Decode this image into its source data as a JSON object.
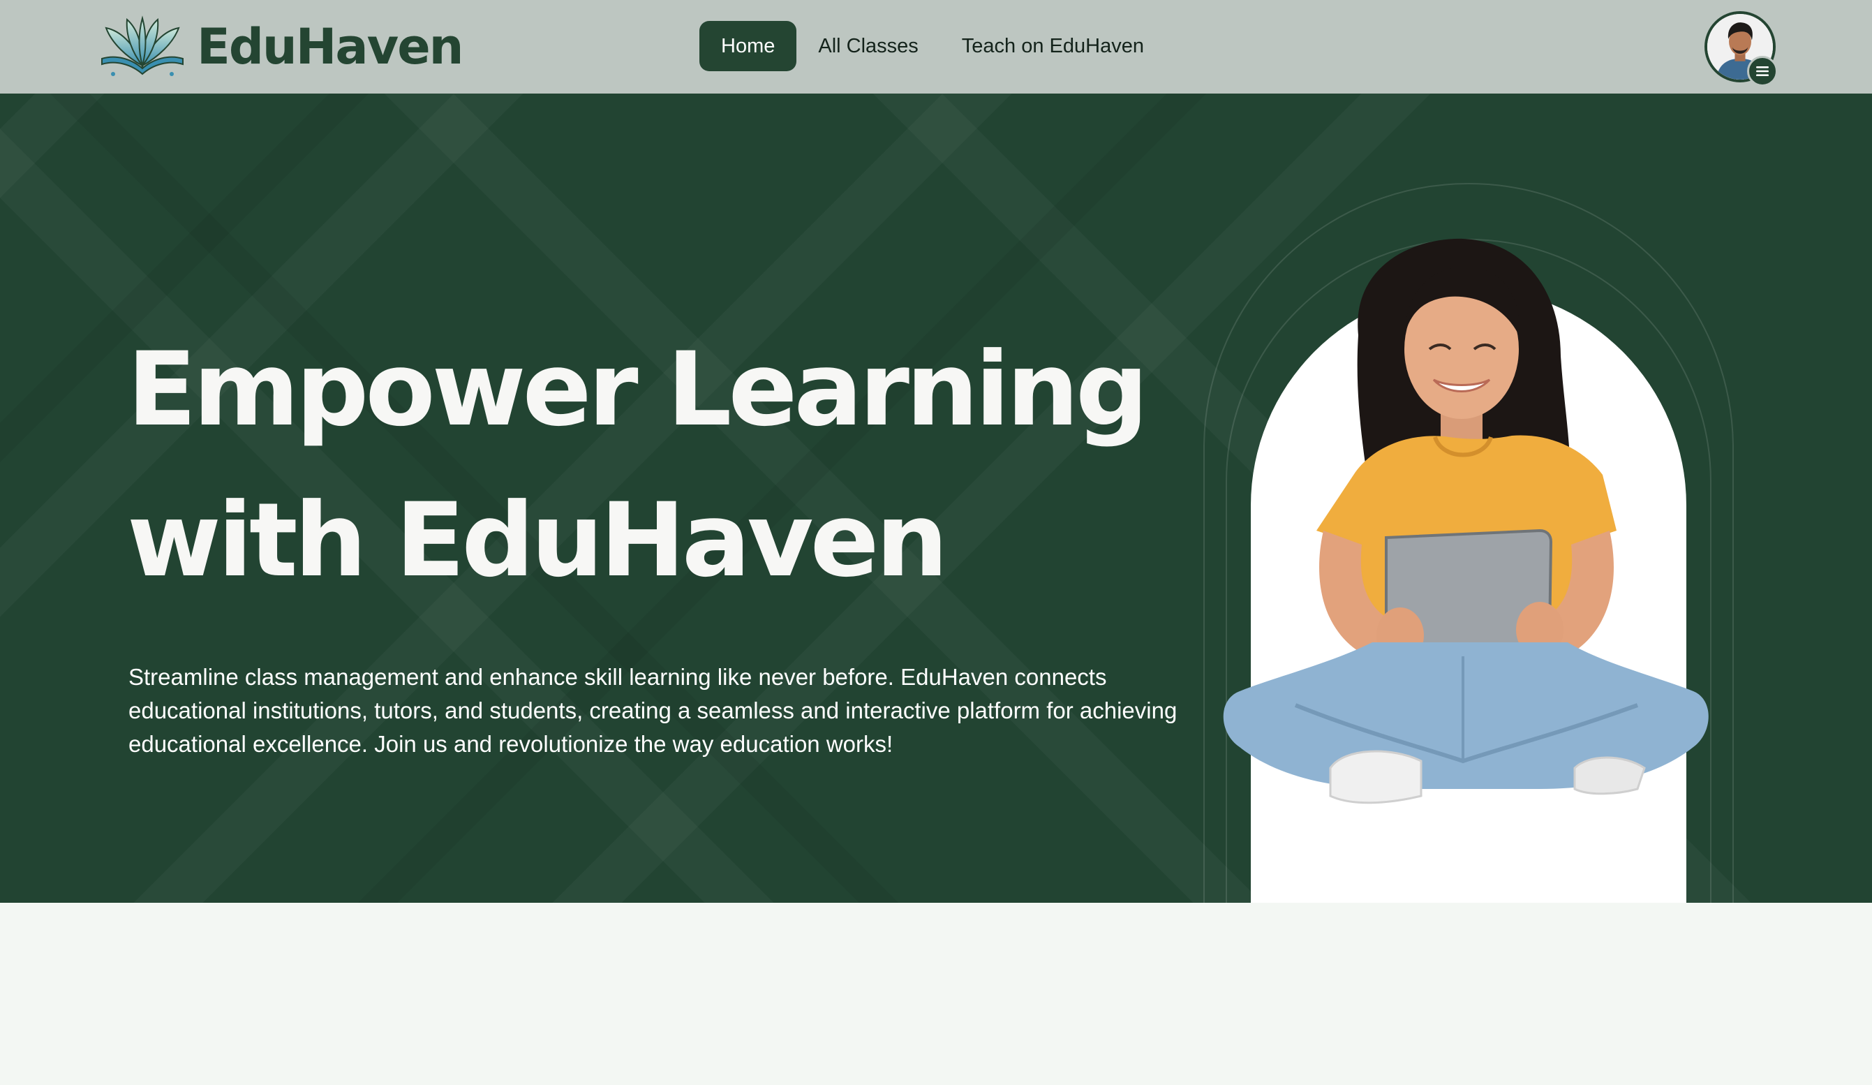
{
  "brand": {
    "name": "EduHaven",
    "logo_icon": "open-book-logo-icon"
  },
  "nav": {
    "items": [
      {
        "label": "Home",
        "active": true
      },
      {
        "label": "All Classes",
        "active": false
      },
      {
        "label": "Teach on EduHaven",
        "active": false
      }
    ]
  },
  "user": {
    "avatar_icon": "user-avatar",
    "menu_icon": "hamburger-menu-icon"
  },
  "hero": {
    "title": "Empower Learning with EduHaven",
    "description": "Streamline class management and enhance skill learning like never before. EduHaven connects educational institutions, tutors, and students, creating a seamless and interactive platform for achieving educational excellence. Join us and revolutionize the way education works!",
    "image_icon": "student-with-tablet-illustration"
  },
  "colors": {
    "primary": "#244532",
    "navbar_bg": "#bdc6c1",
    "hero_bg": "#224432",
    "page_bg": "#f3f7f3"
  }
}
